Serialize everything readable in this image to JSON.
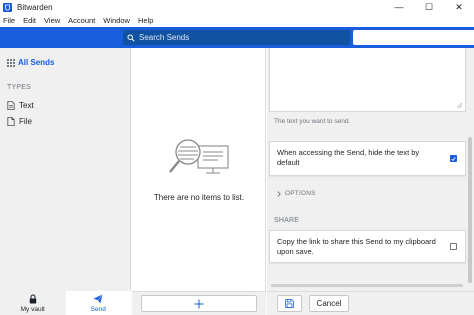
{
  "window": {
    "title": "Bitwarden",
    "controls": {
      "minimize": "—",
      "maximize": "☐",
      "close": "✕"
    }
  },
  "menu": [
    "File",
    "Edit",
    "View",
    "Account",
    "Window",
    "Help"
  ],
  "header": {
    "search_placeholder": "Search Sends",
    "accent_color": "#175ddc"
  },
  "sidebar": {
    "all_sends": "All Sends",
    "types_heading": "TYPES",
    "types": [
      {
        "label": "Text",
        "icon": "text-file-icon"
      },
      {
        "label": "File",
        "icon": "file-icon"
      }
    ],
    "nav": [
      {
        "label": "My vault",
        "icon": "lock-icon",
        "active": false
      },
      {
        "label": "Send",
        "icon": "paper-plane-icon",
        "active": true
      }
    ]
  },
  "list": {
    "empty_text": "There are no items to list.",
    "add_icon": "plus-icon"
  },
  "detail": {
    "notes_value": "",
    "notes_help": "The text you want to send.",
    "hide_text_label": "When accessing the Send, hide the text by default",
    "hide_text_checked": true,
    "options_label": "OPTIONS",
    "share_heading": "SHARE",
    "copy_link_label": "Copy the link to share this Send to my clipboard upon save.",
    "copy_link_checked": false,
    "cancel_label": "Cancel",
    "save_icon": "save-icon"
  }
}
